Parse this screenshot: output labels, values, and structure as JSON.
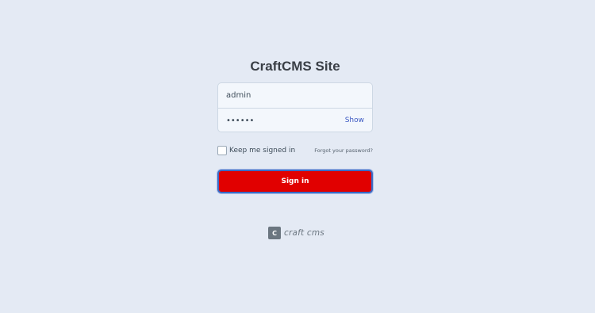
{
  "login": {
    "title": "CraftCMS Site",
    "username": {
      "value": "admin"
    },
    "password": {
      "value": "••••••",
      "show_label": "Show"
    },
    "remember": {
      "label": "Keep me signed in",
      "checked": false
    },
    "forgot_label": "Forgot your password?",
    "submit_label": "Sign in"
  },
  "footer": {
    "logo_mark": "C",
    "logo_text": "craft cms"
  },
  "colors": {
    "background": "#e4eaf4",
    "button_bg": "#e10000",
    "button_border": "#3a6bc6",
    "link": "#3b59c2"
  }
}
